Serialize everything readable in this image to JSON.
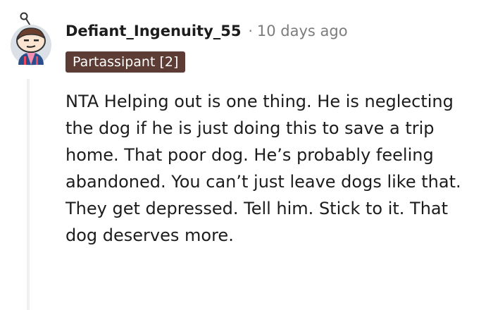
{
  "comment": {
    "author": "Defiant_Ingenuity_55",
    "separator": "·",
    "timestamp": "10 days ago",
    "flair": "Partassipant [2]",
    "body": "NTA Helping out is one thing. He is neglecting the dog if he is just doing this to save a trip home. That poor dog. He’s probably feeling abandoned. You can’t just leave dogs like that. They get depressed. Tell him. Stick to it. That dog deserves more."
  },
  "colors": {
    "flair_background": "#5c3c35",
    "meta_text": "#7c7c7c",
    "body_text": "#1c1c1c",
    "thread_line": "#edeff1"
  },
  "icons": {
    "avatar": "snoo-avatar-icon"
  }
}
